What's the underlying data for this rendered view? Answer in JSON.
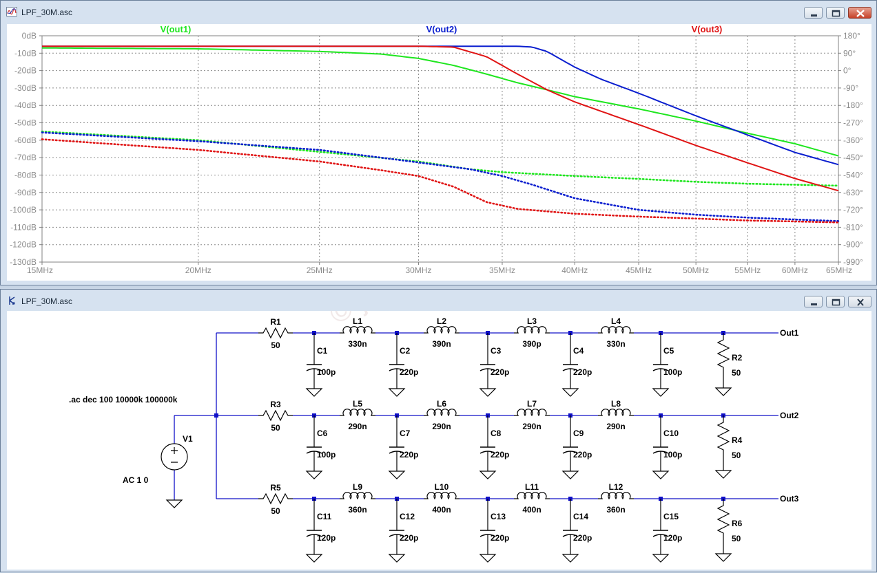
{
  "plot_window": {
    "title": "LPF_30M.asc",
    "controls": {
      "minimize": "minimize-icon",
      "maximize": "maximize-icon",
      "close": "close-icon"
    }
  },
  "schematic_window": {
    "title": "LPF_30M.asc"
  },
  "chart_data": {
    "type": "line",
    "x_scale": "log",
    "xlim": [
      15,
      65
    ],
    "x_unit": "MHz",
    "x_ticks": [
      "15MHz",
      "20MHz",
      "25MHz",
      "30MHz",
      "35MHz",
      "40MHz",
      "45MHz",
      "50MHz",
      "55MHz",
      "60MHz",
      "65MHz"
    ],
    "x_tick_values": [
      15,
      20,
      25,
      30,
      35,
      40,
      45,
      50,
      55,
      60,
      65
    ],
    "ylim_left": [
      -130,
      0
    ],
    "y_ticks_left": [
      "0dB",
      "-10dB",
      "-20dB",
      "-30dB",
      "-40dB",
      "-50dB",
      "-60dB",
      "-70dB",
      "-80dB",
      "-90dB",
      "-100dB",
      "-110dB",
      "-120dB",
      "-130dB"
    ],
    "ylim_right": [
      -990,
      180
    ],
    "y_ticks_right": [
      "180°",
      "90°",
      "0°",
      "-90°",
      "-180°",
      "-270°",
      "-360°",
      "-450°",
      "-540°",
      "-630°",
      "-720°",
      "-810°",
      "-900°",
      "-990°"
    ],
    "grid": true,
    "series": [
      {
        "name": "V(out1)",
        "color": "#1ee61e",
        "magnitude": [
          [
            15,
            -7
          ],
          [
            20,
            -7.5
          ],
          [
            25,
            -9
          ],
          [
            28,
            -10.5
          ],
          [
            30,
            -13
          ],
          [
            32,
            -17
          ],
          [
            34,
            -22
          ],
          [
            36,
            -27
          ],
          [
            38,
            -31
          ],
          [
            40,
            -35
          ],
          [
            45,
            -42
          ],
          [
            50,
            -49
          ],
          [
            55,
            -56
          ],
          [
            60,
            -62
          ],
          [
            65,
            -69
          ]
        ],
        "phase": [
          [
            15,
            -315
          ],
          [
            20,
            -360
          ],
          [
            25,
            -420
          ],
          [
            30,
            -470
          ],
          [
            33,
            -510
          ],
          [
            35,
            -525
          ],
          [
            40,
            -545
          ],
          [
            45,
            -560
          ],
          [
            50,
            -575
          ],
          [
            55,
            -585
          ],
          [
            60,
            -590
          ],
          [
            65,
            -595
          ]
        ]
      },
      {
        "name": "V(out2)",
        "color": "#0a1ecf",
        "magnitude": [
          [
            15,
            -6
          ],
          [
            20,
            -6
          ],
          [
            30,
            -6
          ],
          [
            34,
            -6
          ],
          [
            36,
            -6
          ],
          [
            37,
            -6.5
          ],
          [
            38,
            -9
          ],
          [
            40,
            -18
          ],
          [
            42,
            -25
          ],
          [
            45,
            -33
          ],
          [
            50,
            -46
          ],
          [
            55,
            -57
          ],
          [
            60,
            -67
          ],
          [
            65,
            -74
          ]
        ],
        "phase": [
          [
            15,
            -320
          ],
          [
            20,
            -365
          ],
          [
            25,
            -410
          ],
          [
            28,
            -450
          ],
          [
            30,
            -475
          ],
          [
            33,
            -510
          ],
          [
            35,
            -545
          ],
          [
            37,
            -590
          ],
          [
            40,
            -660
          ],
          [
            45,
            -720
          ],
          [
            50,
            -745
          ],
          [
            55,
            -760
          ],
          [
            60,
            -770
          ],
          [
            65,
            -778
          ]
        ]
      },
      {
        "name": "V(out3)",
        "color": "#e01414",
        "magnitude": [
          [
            15,
            -6
          ],
          [
            20,
            -6
          ],
          [
            30,
            -6
          ],
          [
            32,
            -6.5
          ],
          [
            34,
            -12
          ],
          [
            36,
            -22
          ],
          [
            38,
            -31
          ],
          [
            40,
            -38
          ],
          [
            45,
            -51
          ],
          [
            50,
            -63
          ],
          [
            55,
            -73
          ],
          [
            60,
            -82
          ],
          [
            65,
            -89
          ]
        ],
        "phase": [
          [
            15,
            -355
          ],
          [
            20,
            -410
          ],
          [
            25,
            -470
          ],
          [
            28,
            -515
          ],
          [
            30,
            -545
          ],
          [
            32,
            -600
          ],
          [
            34,
            -680
          ],
          [
            36,
            -715
          ],
          [
            40,
            -740
          ],
          [
            45,
            -755
          ],
          [
            50,
            -765
          ],
          [
            55,
            -775
          ],
          [
            60,
            -780
          ],
          [
            65,
            -785
          ]
        ]
      }
    ]
  },
  "schematic": {
    "resistors": [
      {
        "ref": "R1",
        "value": "50"
      },
      {
        "ref": "R3",
        "value": "50"
      },
      {
        "ref": "R5",
        "value": "50"
      },
      {
        "ref": "R2",
        "value": "50"
      },
      {
        "ref": "R4",
        "value": "50"
      },
      {
        "ref": "R6",
        "value": "50"
      }
    ],
    "inductor_rows": [
      [
        {
          "ref": "L1",
          "value": "330n"
        },
        {
          "ref": "L2",
          "value": "390n"
        },
        {
          "ref": "L3",
          "value": "390p"
        },
        {
          "ref": "L4",
          "value": "330n"
        }
      ],
      [
        {
          "ref": "L5",
          "value": "290n"
        },
        {
          "ref": "L6",
          "value": "290n"
        },
        {
          "ref": "L7",
          "value": "290n"
        },
        {
          "ref": "L8",
          "value": "290n"
        }
      ],
      [
        {
          "ref": "L9",
          "value": "360n"
        },
        {
          "ref": "L10",
          "value": "400n"
        },
        {
          "ref": "L11",
          "value": "400n"
        },
        {
          "ref": "L12",
          "value": "360n"
        }
      ]
    ],
    "capacitor_rows": [
      [
        {
          "ref": "C1",
          "value": "100p"
        },
        {
          "ref": "C2",
          "value": "220p"
        },
        {
          "ref": "C3",
          "value": "220p"
        },
        {
          "ref": "C4",
          "value": "220p"
        },
        {
          "ref": "C5",
          "value": "100p"
        }
      ],
      [
        {
          "ref": "C6",
          "value": "100p"
        },
        {
          "ref": "C7",
          "value": "220p"
        },
        {
          "ref": "C8",
          "value": "220p"
        },
        {
          "ref": "C9",
          "value": "220p"
        },
        {
          "ref": "C10",
          "value": "100p"
        }
      ],
      [
        {
          "ref": "C11",
          "value": "120p"
        },
        {
          "ref": "C12",
          "value": "220p"
        },
        {
          "ref": "C13",
          "value": "220p"
        },
        {
          "ref": "C14",
          "value": "220p"
        },
        {
          "ref": "C15",
          "value": "120p"
        }
      ]
    ],
    "outputs": [
      "Out1",
      "Out2",
      "Out3"
    ],
    "source": {
      "ref": "V1",
      "value": "AC 1 0"
    },
    "directive": ".ac dec 100 10000k 100000k"
  },
  "watermark": "© jh4vaj.com"
}
